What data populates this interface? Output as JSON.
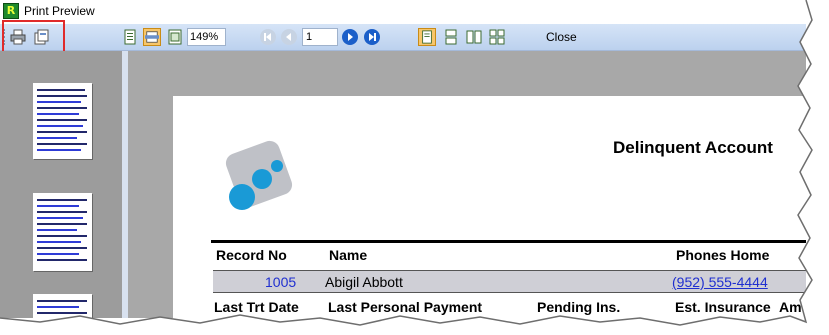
{
  "window": {
    "title": "Print Preview",
    "app_icon_letter": "R"
  },
  "toolbar": {
    "zoom_value": "149%",
    "page_value": "1",
    "close_label": "Close"
  },
  "report": {
    "title": "Delinquent Account",
    "headers": {
      "record_no": "Record No",
      "name": "Name",
      "phones_home": "Phones Home"
    },
    "row": {
      "record_no": "1005",
      "name": "Abigil Abbott",
      "phone": "(952) 555-4444"
    },
    "subheaders": {
      "last_trt_date": "Last Trt Date",
      "last_personal_payment": "Last Personal Payment",
      "pending_ins": "Pending Ins.",
      "est_insurance": "Est. Insurance",
      "am": "Am"
    }
  },
  "colors": {
    "toolbar_top": "#d6e4f7",
    "toolbar_bottom": "#bcd1ee",
    "highlight": "#e02b2b",
    "link_blue": "#1f2fd0",
    "logo_blue": "#1a9ad6"
  }
}
